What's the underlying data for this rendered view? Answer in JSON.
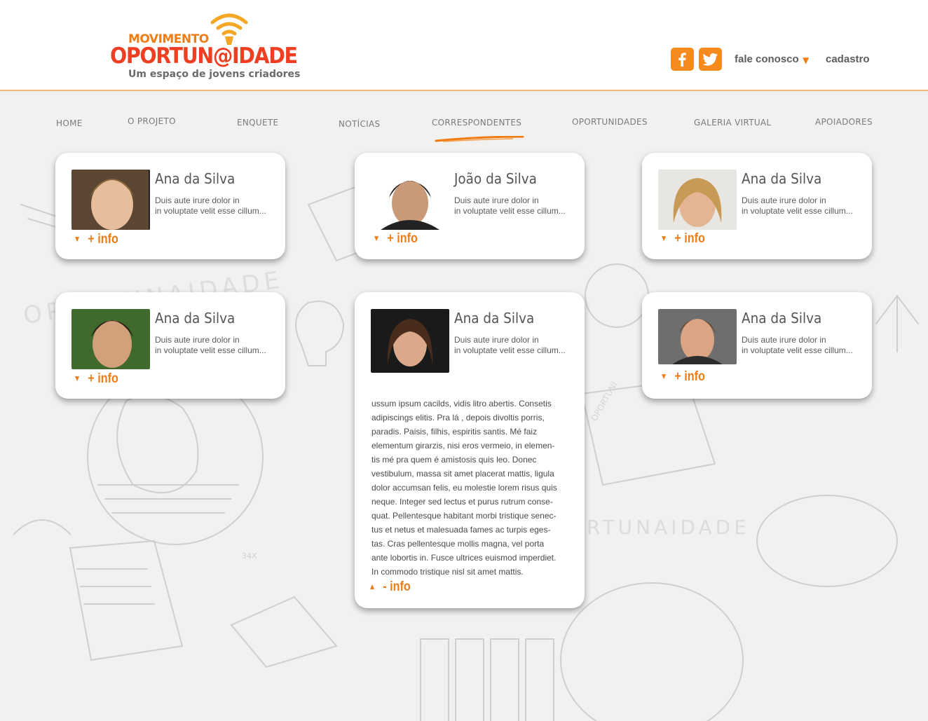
{
  "brand": {
    "top": "MOVIMENTO",
    "main": "OPORTUN@IDADE",
    "tagline": "Um espaço de jovens criadores",
    "accent": "#f07c16",
    "red": "#ee3f23"
  },
  "header": {
    "social": [
      "facebook-icon",
      "twitter-icon"
    ],
    "fale": "fale conosco",
    "fale_arrow": "▼",
    "cadastro": "cadastro"
  },
  "nav": {
    "items": [
      "HOME",
      "O PROJETO",
      "ENQUETE",
      "NOTÍCIAS",
      "CORRESPONDENTES",
      "OPORTUNIDADES",
      "GALERIA VIRTUAL",
      "APOIADORES"
    ],
    "active": "CORRESPONDENTES"
  },
  "cards": [
    {
      "name": "Ana da Silva",
      "line1": "Duis aute irure dolor in",
      "line2": "in voluptate velit esse cillum...",
      "toggle": "+ info",
      "arrow": "▼"
    },
    {
      "name": "João da Silva",
      "line1": "Duis aute irure dolor in",
      "line2": "in voluptate velit esse cillum...",
      "toggle": "+ info",
      "arrow": "▼"
    },
    {
      "name": "Ana da Silva",
      "line1": "Duis aute irure dolor in",
      "line2": "in voluptate velit esse cillum...",
      "toggle": "+ info",
      "arrow": "▼"
    },
    {
      "name": "Ana da Silva",
      "line1": "Duis aute irure dolor in",
      "line2": "in voluptate velit esse cillum...",
      "toggle": "+ info",
      "arrow": "▼"
    },
    {
      "name": "Ana da Silva",
      "line1": "Duis aute irure dolor in",
      "line2": "in voluptate velit esse cillum...",
      "toggle": "- info",
      "arrow": "▲",
      "body": [
        "ussum ipsum cacilds, vidis litro abertis. Consetis",
        "adipiscings elitis. Pra lá , depois divoltis porris,",
        "paradis. Paisis, filhis, espiritis santis. Mé faiz",
        "elementum girarzis, nisi eros vermeio, in elemen-",
        "tis mé pra quem é amistosis quis leo. Donec",
        "vestibulum, massa sit amet placerat mattis, ligula",
        "dolor accumsan felis, eu molestie lorem risus quis",
        "neque. Integer sed lectus et purus rutrum conse-",
        "quat. Pellentesque habitant morbi tristique senec-",
        "tus et netus et malesuada fames ac turpis eges-",
        "tas. Cras pellentesque mollis magna, vel porta",
        "ante lobortis in. Fusce ultrices euismod imperdiet.",
        "In commodo tristique nisl sit amet mattis."
      ]
    },
    {
      "name": "Ana da Silva",
      "line1": "Duis aute irure dolor in",
      "line2": "in voluptate velit esse cillum...",
      "toggle": "+ info",
      "arrow": "▼"
    }
  ],
  "background": {
    "watermark1": "OPORTUNAIDADE",
    "watermark2": "ORTUNAIDADE",
    "watermark3": "OPORTUNI",
    "sticker": "34X"
  }
}
